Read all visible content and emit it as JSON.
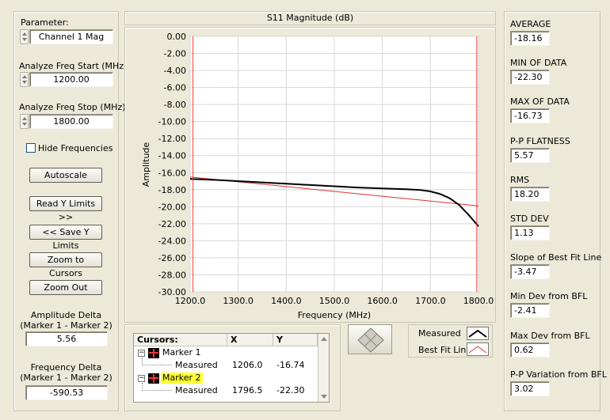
{
  "left": {
    "parameter_label": "Parameter:",
    "parameter_value": "Channel 1 Mag",
    "start_label": "Analyze Freq Start (MHz)",
    "start_value": "1200.00",
    "stop_label": "Analyze Freq Stop (MHz)",
    "stop_value": "1800.00",
    "hide_freq_label": "Hide Frequencies",
    "hide_freq_checked": false,
    "buttons": {
      "autoscale": "Autoscale",
      "read_y": "Read Y Limits >>",
      "save_y": "<< Save Y Limits",
      "zoom_cursors": "Zoom to Cursors",
      "zoom_out": "Zoom Out"
    },
    "amp_delta_label1": "Amplitude Delta",
    "amp_delta_label2": "(Marker 1 - Marker 2)",
    "amp_delta_value": "5.56",
    "freq_delta_label1": "Frequency Delta",
    "freq_delta_label2": "(Marker 1 - Marker 2)",
    "freq_delta_value": "-590.53"
  },
  "chart": {
    "title": "S11 Magnitude (dB)",
    "xlabel": "Frequency (MHz)",
    "ylabel": "Amplitude",
    "y_ticks": [
      "0.00",
      "-2.00",
      "-4.00",
      "-6.00",
      "-8.00",
      "-10.00",
      "-12.00",
      "-14.00",
      "-16.00",
      "-18.00",
      "-20.00",
      "-22.00",
      "-24.00",
      "-26.00",
      "-28.00",
      "-30.00"
    ],
    "x_ticks": [
      "1200.0",
      "1300.0",
      "1400.0",
      "1500.0",
      "1600.0",
      "1700.0",
      "1800.0"
    ]
  },
  "chart_data": {
    "type": "line",
    "title": "S11 Magnitude (dB)",
    "xlabel": "Frequency (MHz)",
    "ylabel": "Amplitude",
    "xlim": [
      1200,
      1800
    ],
    "ylim": [
      -30,
      0
    ],
    "grid": true,
    "series": [
      {
        "name": "Measured",
        "color": "#000000",
        "x": [
          1200,
          1250,
          1300,
          1350,
          1400,
          1450,
          1500,
          1550,
          1600,
          1650,
          1680,
          1700,
          1720,
          1740,
          1760,
          1780,
          1800
        ],
        "y": [
          -16.74,
          -16.85,
          -17.0,
          -17.15,
          -17.3,
          -17.45,
          -17.6,
          -17.75,
          -17.85,
          -17.95,
          -18.05,
          -18.2,
          -18.5,
          -19.0,
          -19.8,
          -21.0,
          -22.3
        ]
      },
      {
        "name": "Best Fit Line",
        "color": "#e03030",
        "x": [
          1200,
          1800
        ],
        "y": [
          -16.5,
          -19.9
        ]
      }
    ],
    "cursors": [
      {
        "name": "Marker 1",
        "x": 1206.0,
        "y": -16.74
      },
      {
        "name": "Marker 2",
        "x": 1796.5,
        "y": -22.3
      }
    ]
  },
  "cursors_table": {
    "headers": [
      "Cursors:",
      "X",
      "Y"
    ],
    "rows": [
      {
        "marker": "Marker 1",
        "sub": "Measured",
        "x": "1206.0",
        "y": "-16.74"
      },
      {
        "marker": "Marker 2",
        "sub": "Measured",
        "x": "1796.5",
        "y": "-22.30"
      }
    ]
  },
  "legend": {
    "measured": "Measured",
    "bestfit": "Best Fit Line"
  },
  "stats": [
    {
      "label": "AVERAGE",
      "value": "-18.16"
    },
    {
      "label": "MIN OF DATA",
      "value": "-22.30"
    },
    {
      "label": "MAX OF DATA",
      "value": "-16.73"
    },
    {
      "label": "P-P FLATNESS",
      "value": "5.57"
    },
    {
      "label": "RMS",
      "value": "18.20"
    },
    {
      "label": "STD DEV",
      "value": "1.13"
    },
    {
      "label": "Slope of Best Fit Line",
      "value": "-3.47"
    },
    {
      "label": "Min Dev from BFL",
      "value": "-2.41"
    },
    {
      "label": "Max Dev from BFL",
      "value": "0.62"
    },
    {
      "label": "P-P Variation from BFL",
      "value": "3.02"
    }
  ],
  "colors": {
    "background": "#ece9d8",
    "marker_highlight": "#ffff33",
    "cursor_line": "#ff3333"
  }
}
